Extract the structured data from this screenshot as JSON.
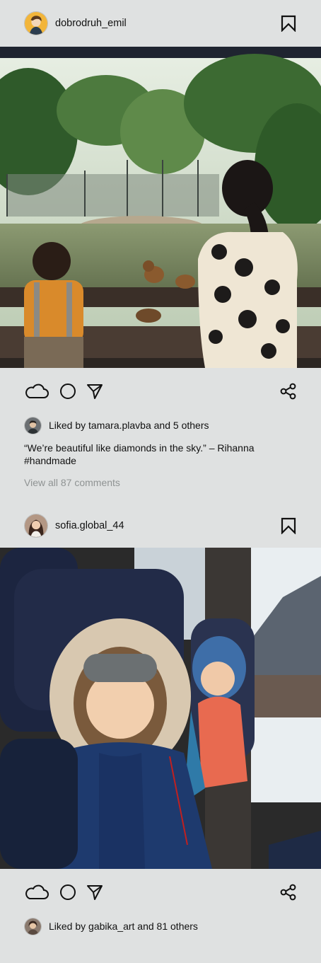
{
  "posts": [
    {
      "username": "dobrodruh_emil",
      "likes_text": "Liked by tamara.plavba and 5 others",
      "caption_line1": "“We’re beautiful like diamonds in the sky.” – Rihanna",
      "caption_line2": "#handmade",
      "view_comments": "View all 87 comments",
      "photo_subject": "children-watching-monkeys-at-zoo"
    },
    {
      "username": "sofia.global_44",
      "likes_text": "Liked by gabika_art and 81 others",
      "photo_subject": "girls-on-train-in-winter-coats"
    }
  ],
  "icons": {
    "bookmark": "bookmark-icon",
    "like": "cloud-icon",
    "comment": "circle-icon",
    "send": "send-icon",
    "share": "share-icon"
  },
  "colors": {
    "background": "#dfe1e1",
    "text": "#111111",
    "muted": "#8f9393"
  }
}
